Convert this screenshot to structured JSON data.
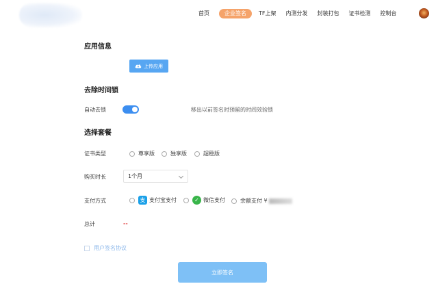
{
  "nav": {
    "items": [
      "首页",
      "企业签名",
      "TF上架",
      "内测分发",
      "封装打包",
      "证书检测",
      "控制台"
    ],
    "active_index": 1
  },
  "app_info": {
    "title": "应用信息",
    "upload_label": "上传应用"
  },
  "remove_lock": {
    "title": "去除时间锁",
    "auto_label": "自动去锁",
    "description": "移出以前签名时预留的时间效验锁",
    "enabled": true
  },
  "package": {
    "title": "选择套餐",
    "cert_type_label": "证书类型",
    "cert_options": [
      "尊享版",
      "独享版",
      "超稳版"
    ],
    "duration_label": "购买时长",
    "duration_value": "1个月",
    "payment_label": "支付方式",
    "payment_options": [
      "支付宝支付",
      "微信支付",
      "余额支付 ¥"
    ],
    "total_label": "总计",
    "total_value": "--"
  },
  "agreement": {
    "label": "用户签名协议"
  },
  "submit": {
    "label": "立即签名"
  },
  "colors": {
    "primary": "#3c8ef0",
    "nav_active": "#f5a36a",
    "submit": "#7ec0f6",
    "total": "#e23c3c"
  }
}
